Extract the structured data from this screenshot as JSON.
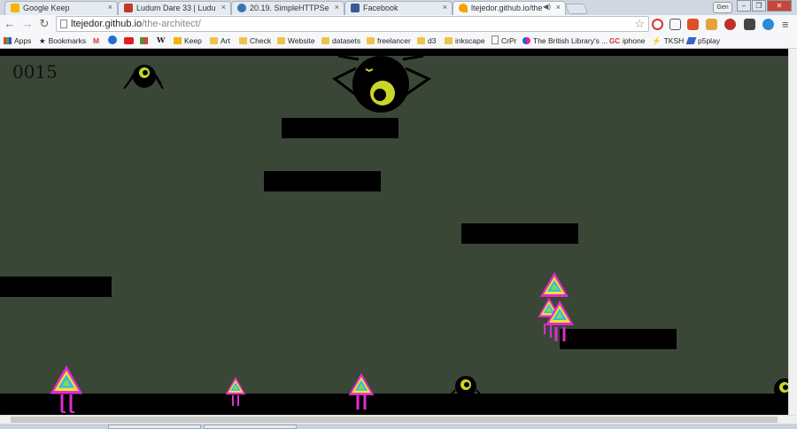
{
  "tabs": [
    {
      "title": "Google Keep",
      "close": "×",
      "color": "#f5b400"
    },
    {
      "title": "Ludum Dare 33 | Ludum D",
      "close": "×",
      "color": "#c0392b"
    },
    {
      "title": "20.19. SimpleHTTPServer",
      "close": "×",
      "color": "#3a73b5"
    },
    {
      "title": "Facebook",
      "close": "×",
      "color": "#3b5998"
    },
    {
      "title": "ltejedor.github.io/the-",
      "close": "×",
      "color": "#f0a500",
      "active": true
    }
  ],
  "window": {
    "profile": "Gen",
    "min": "–",
    "max": "❐",
    "close": "✕"
  },
  "toolbar": {
    "back": "←",
    "forward": "→",
    "reload": "↻",
    "url_host": "ltejedor.github.io",
    "url_path": "/the-architect/",
    "star": "☆",
    "menu": "≡"
  },
  "bookmarks": [
    {
      "label": "Apps",
      "icon": "apps-icon"
    },
    {
      "label": "Bookmarks",
      "icon": "star-icon"
    },
    {
      "label": "M",
      "icon": "gmail-icon"
    },
    {
      "label": "",
      "icon": "blue-circle-icon"
    },
    {
      "label": "",
      "icon": "youtube-icon"
    },
    {
      "label": "",
      "icon": "maps-icon"
    },
    {
      "label": "W",
      "icon": "wikipedia-icon"
    },
    {
      "label": "Keep",
      "icon": "keep-icon"
    },
    {
      "label": "Art",
      "icon": "folder-icon"
    },
    {
      "label": "Check",
      "icon": "folder-icon"
    },
    {
      "label": "Website",
      "icon": "folder-icon"
    },
    {
      "label": "datasets",
      "icon": "folder-icon"
    },
    {
      "label": "freelancer",
      "icon": "folder-icon"
    },
    {
      "label": "d3",
      "icon": "folder-icon"
    },
    {
      "label": "inkscape",
      "icon": "folder-icon"
    },
    {
      "label": "CrPr",
      "icon": "page-icon"
    },
    {
      "label": "The British Library's ...",
      "icon": "flickr-icon"
    },
    {
      "label": "iphone",
      "icon": "gc-icon"
    },
    {
      "label": "TKSH",
      "icon": "bolt-icon"
    },
    {
      "label": "p5play",
      "icon": "rocket-icon"
    }
  ],
  "game": {
    "score": "0015",
    "colors": {
      "background": "#3a4737",
      "eye": "#c8d62a",
      "ground": "#000000"
    }
  }
}
